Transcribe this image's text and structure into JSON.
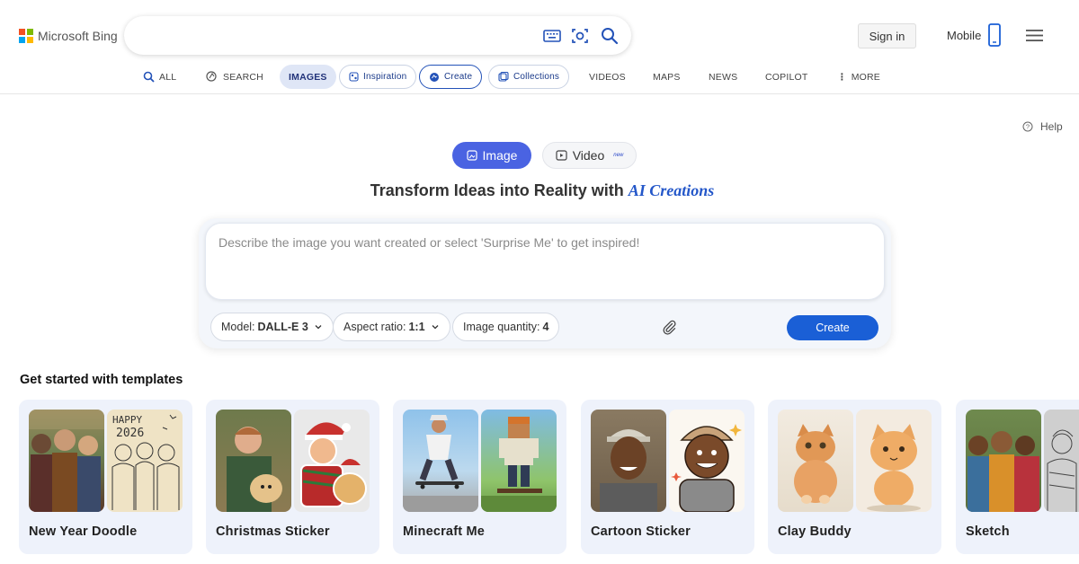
{
  "header": {
    "logo_text": "Microsoft Bing",
    "sign_in": "Sign in",
    "mobile": "Mobile",
    "brand_colors": [
      "#f25022",
      "#7fba00",
      "#00a4ef",
      "#ffb900"
    ]
  },
  "nav": {
    "all": "ALL",
    "search": "SEARCH",
    "images": "IMAGES",
    "inspiration": "Inspiration",
    "create": "Create",
    "collections": "Collections",
    "videos": "VIDEOS",
    "maps": "MAPS",
    "news": "NEWS",
    "copilot": "COPILOT",
    "more": "MORE"
  },
  "help": "Help",
  "toggle": {
    "image": "Image",
    "video": "Video",
    "video_badge": "new"
  },
  "headline": {
    "main": "Transform Ideas into Reality with",
    "accent": "AI Creations"
  },
  "prompt": {
    "placeholder": "Describe the image you want created or select 'Surprise Me' to get inspired!"
  },
  "options": {
    "model_label": "Model:",
    "model_value": "DALL-E 3",
    "aspect_label": "Aspect ratio:",
    "aspect_value": "1:1",
    "quantity_label": "Image quantity:",
    "quantity_value": "4"
  },
  "create_button": "Create",
  "templates": {
    "title": "Get started with templates",
    "items": [
      {
        "label": "New Year Doodle"
      },
      {
        "label": "Christmas Sticker"
      },
      {
        "label": "Minecraft Me"
      },
      {
        "label": "Cartoon Sticker"
      },
      {
        "label": "Clay Buddy"
      },
      {
        "label": "Sketch"
      }
    ],
    "doodle_text": "HAPPY 2026"
  },
  "colors": {
    "accent": "#4a63e2",
    "create_button": "#1a5fd6"
  }
}
